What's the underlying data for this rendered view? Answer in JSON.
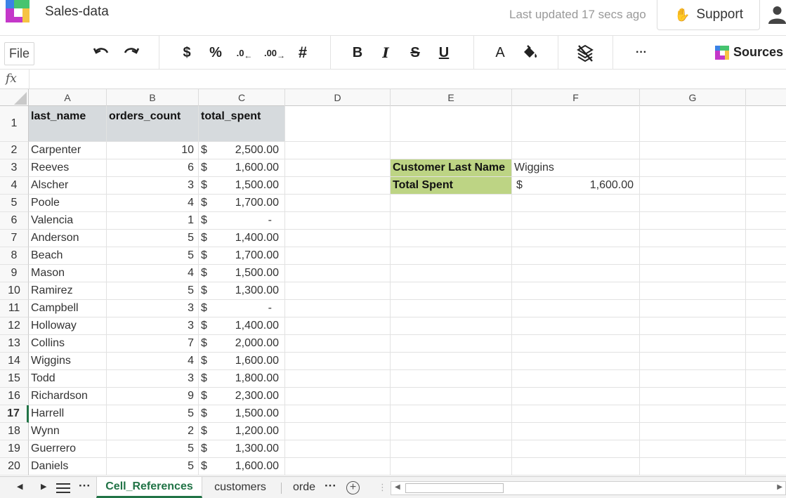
{
  "header": {
    "doc_title": "Sales-data",
    "last_updated": "Last updated 17 secs ago",
    "support_label": "Support"
  },
  "toolbar": {
    "file_label": "File",
    "currency_label": "$",
    "percent_label": "%",
    "dec_decrease_label": ".0",
    "dec_increase_label": ".00",
    "number_format_label": "#",
    "bold_label": "B",
    "italic_label": "I",
    "strike_label": "S",
    "underline_label": "U",
    "font_color_label": "A",
    "more_label": "···",
    "sources_label": "Sources"
  },
  "formula_bar": {
    "fx_label": "fx"
  },
  "grid": {
    "columns": [
      "A",
      "B",
      "C",
      "D",
      "E",
      "F",
      "G"
    ],
    "row_numbers": [
      "1",
      "2",
      "3",
      "4",
      "5",
      "6",
      "7",
      "8",
      "9",
      "10",
      "11",
      "12",
      "13",
      "14",
      "15",
      "16",
      "17",
      "18",
      "19",
      "20"
    ],
    "active_row": "17",
    "headers": {
      "a": "last_name",
      "b": "orders_count",
      "c": "total_spent"
    },
    "rows": [
      {
        "last_name": "Carpenter",
        "orders_count": "10",
        "currency": "$",
        "total_spent": "2,500.00"
      },
      {
        "last_name": "Reeves",
        "orders_count": "6",
        "currency": "$",
        "total_spent": "1,600.00"
      },
      {
        "last_name": "Alscher",
        "orders_count": "3",
        "currency": "$",
        "total_spent": "1,500.00"
      },
      {
        "last_name": "Poole",
        "orders_count": "4",
        "currency": "$",
        "total_spent": "1,700.00"
      },
      {
        "last_name": "Valencia",
        "orders_count": "1",
        "currency": "$",
        "total_spent": "-"
      },
      {
        "last_name": "Anderson",
        "orders_count": "5",
        "currency": "$",
        "total_spent": "1,400.00"
      },
      {
        "last_name": "Beach",
        "orders_count": "5",
        "currency": "$",
        "total_spent": "1,700.00"
      },
      {
        "last_name": "Mason",
        "orders_count": "4",
        "currency": "$",
        "total_spent": "1,500.00"
      },
      {
        "last_name": "Ramirez",
        "orders_count": "5",
        "currency": "$",
        "total_spent": "1,300.00"
      },
      {
        "last_name": "Campbell",
        "orders_count": "3",
        "currency": "$",
        "total_spent": "-"
      },
      {
        "last_name": "Holloway",
        "orders_count": "3",
        "currency": "$",
        "total_spent": "1,400.00"
      },
      {
        "last_name": "Collins",
        "orders_count": "7",
        "currency": "$",
        "total_spent": "2,000.00"
      },
      {
        "last_name": "Wiggins",
        "orders_count": "4",
        "currency": "$",
        "total_spent": "1,600.00"
      },
      {
        "last_name": "Todd",
        "orders_count": "3",
        "currency": "$",
        "total_spent": "1,800.00"
      },
      {
        "last_name": "Richardson",
        "orders_count": "9",
        "currency": "$",
        "total_spent": "2,300.00"
      },
      {
        "last_name": "Harrell",
        "orders_count": "5",
        "currency": "$",
        "total_spent": "1,500.00"
      },
      {
        "last_name": "Wynn",
        "orders_count": "2",
        "currency": "$",
        "total_spent": "1,200.00"
      },
      {
        "last_name": "Guerrero",
        "orders_count": "5",
        "currency": "$",
        "total_spent": "1,300.00"
      },
      {
        "last_name": "Daniels",
        "orders_count": "5",
        "currency": "$",
        "total_spent": "1,600.00"
      }
    ],
    "lookup": {
      "label_name": "Customer Last Name",
      "value_name": "Wiggins",
      "label_total": "Total Spent",
      "currency": "$",
      "value_total": "1,600.00"
    }
  },
  "sheets": {
    "tabs": [
      "Cell_References",
      "customers",
      "orde"
    ],
    "active": "Cell_References",
    "more_label": "···"
  },
  "colors": {
    "accent_green": "#217346",
    "header_fill": "#d6dadd",
    "lookup_fill": "#bdd484"
  }
}
